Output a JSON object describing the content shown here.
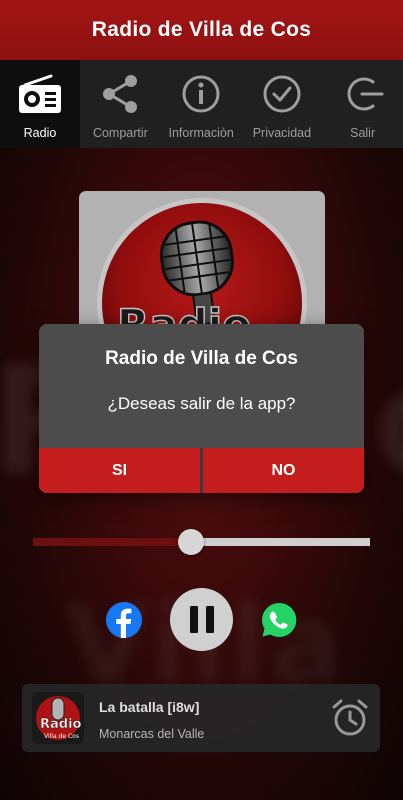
{
  "app": {
    "title": "Radio de Villa de Cos"
  },
  "tabs": [
    {
      "label": "Radio",
      "icon": "radio-icon",
      "active": true
    },
    {
      "label": "Compartir",
      "icon": "share-icon"
    },
    {
      "label": "Informaciòn",
      "icon": "info-icon"
    },
    {
      "label": "Privacidad",
      "icon": "check-circle-icon"
    },
    {
      "label": "Salir",
      "icon": "exit-icon"
    }
  ],
  "logo": {
    "text": "Radio",
    "subtext": "Villa de Cos"
  },
  "dialog": {
    "title": "Radio de Villa de Cos",
    "message": "¿Deseas salir de la app?",
    "yes_label": "SI",
    "no_label": "NO"
  },
  "player": {
    "progress": 0.47,
    "state": "playing"
  },
  "now_playing": {
    "song": "La batalla [i8w]",
    "artist": "Monarcas del Valle"
  },
  "colors": {
    "brand_red": "#a51515",
    "button_red": "#c41d1d",
    "facebook_blue": "#1877f2",
    "whatsapp_green": "#25d366"
  }
}
